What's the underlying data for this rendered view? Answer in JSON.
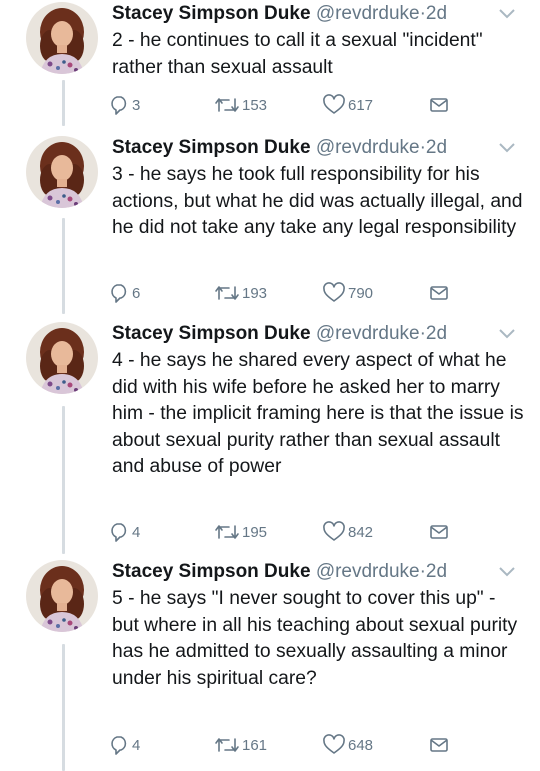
{
  "colors": {
    "text": "#14171a",
    "secondary": "#657786",
    "thread_line": "#d6dce1",
    "background": "#ffffff"
  },
  "icons": {
    "reply": "reply-icon",
    "retweet": "retweet-icon",
    "like": "heart-icon",
    "dm": "envelope-icon",
    "menu": "chevron-down-icon"
  },
  "tweets": [
    {
      "author": "Stacey Simpson Duke",
      "handle": "@revdrduke",
      "dot": "·",
      "time": "2d",
      "text": "2 - he continues to call it a sexual \"incident\" rather than sexual assault",
      "replies": "3",
      "retweets": "153",
      "likes": "617"
    },
    {
      "author": "Stacey Simpson Duke",
      "handle": "@revdrduke",
      "dot": "·",
      "time": "2d",
      "text": "3 - he says he took full responsibility for his actions, but what he did was actually illegal, and he did not take any take any legal responsibility",
      "replies": "6",
      "retweets": "193",
      "likes": "790"
    },
    {
      "author": "Stacey Simpson Duke",
      "handle": "@revdrduke",
      "dot": "·",
      "time": "2d",
      "text": "4 - he says he shared every aspect of what he did with his wife before he asked her to marry him - the implicit framing here is that the issue is about sexual purity rather than sexual assault and abuse of power",
      "replies": "4",
      "retweets": "195",
      "likes": "842"
    },
    {
      "author": "Stacey Simpson Duke",
      "handle": "@revdrduke",
      "dot": "·",
      "time": "2d",
      "text": "5 - he says \"I never sought to cover this up\" - but where in all his teaching about sexual purity has he admitted to sexually assaulting a minor under his spiritual care?",
      "replies": "4",
      "retweets": "161",
      "likes": "648"
    }
  ]
}
